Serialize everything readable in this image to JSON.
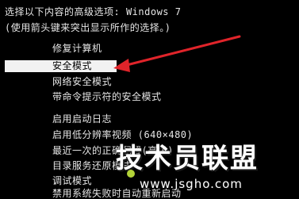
{
  "boot_menu": {
    "header_line1": "选择以下内容的高级选项: Windows 7",
    "header_line2": "(使用箭头键来突出显示所作的选择。)",
    "repair": "修复计算机",
    "items": [
      "安全模式",
      "网络安全模式",
      "带命令提示符的安全模式",
      "启用启动日志",
      "启用低分辨率视频 (640×480)",
      "最近一次的正确配置(高级)",
      "目录服务还原模式",
      "调试模式",
      "禁用系统失败时自动重新启动"
    ]
  },
  "watermark": {
    "title": "技术员联盟",
    "url": "www.jsgho.com"
  },
  "colors": {
    "background": "#000000",
    "text": "#e6e6e6",
    "selection": "#f2f2f2",
    "arrow": "#e0242a",
    "watermark_accent": "#b3d338"
  }
}
